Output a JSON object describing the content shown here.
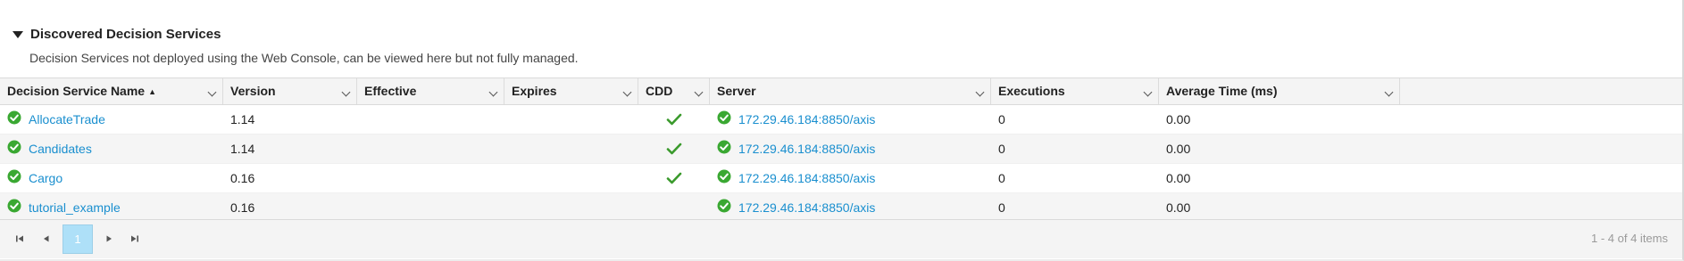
{
  "section": {
    "title": "Discovered Decision Services",
    "description": "Decision Services not deployed using the Web Console, can be viewed here but not fully managed."
  },
  "columns": [
    {
      "key": "name",
      "label": "Decision Service Name",
      "sorted": "ascending"
    },
    {
      "key": "version",
      "label": "Version"
    },
    {
      "key": "effective",
      "label": "Effective"
    },
    {
      "key": "expires",
      "label": "Expires"
    },
    {
      "key": "cdd",
      "label": "CDD"
    },
    {
      "key": "server",
      "label": "Server"
    },
    {
      "key": "executions",
      "label": "Executions"
    },
    {
      "key": "avg_time",
      "label": "Average Time (ms)"
    }
  ],
  "sort_icon": "sort-ascending-icon",
  "rows": [
    {
      "name": "AllocateTrade",
      "status": "ok",
      "version": "1.14",
      "effective": "",
      "expires": "",
      "cdd": true,
      "server_status": "ok",
      "server": "172.29.46.184:8850/axis",
      "executions": "0",
      "avg_time": "0.00"
    },
    {
      "name": "Candidates",
      "status": "ok",
      "version": "1.14",
      "effective": "",
      "expires": "",
      "cdd": true,
      "server_status": "ok",
      "server": "172.29.46.184:8850/axis",
      "executions": "0",
      "avg_time": "0.00"
    },
    {
      "name": "Cargo",
      "status": "ok",
      "version": "0.16",
      "effective": "",
      "expires": "",
      "cdd": true,
      "server_status": "ok",
      "server": "172.29.46.184:8850/axis",
      "executions": "0",
      "avg_time": "0.00"
    },
    {
      "name": "tutorial_example",
      "status": "ok",
      "version": "0.16",
      "effective": "",
      "expires": "",
      "cdd": false,
      "server_status": "ok",
      "server": "172.29.46.184:8850/axis",
      "executions": "0",
      "avg_time": "0.00"
    }
  ],
  "pager": {
    "current_page": "1",
    "info": "1 - 4 of 4 items",
    "icons": [
      "first-page-icon",
      "previous-page-icon",
      "next-page-icon",
      "last-page-icon"
    ]
  },
  "colors": {
    "link": "#1a8fcf",
    "status_ok": "#3aa832",
    "check": "#3a9a2c",
    "page_active": "#aee0f8",
    "header_bg": "#f4f4f4",
    "alt_row_bg": "#f5f5f5"
  }
}
